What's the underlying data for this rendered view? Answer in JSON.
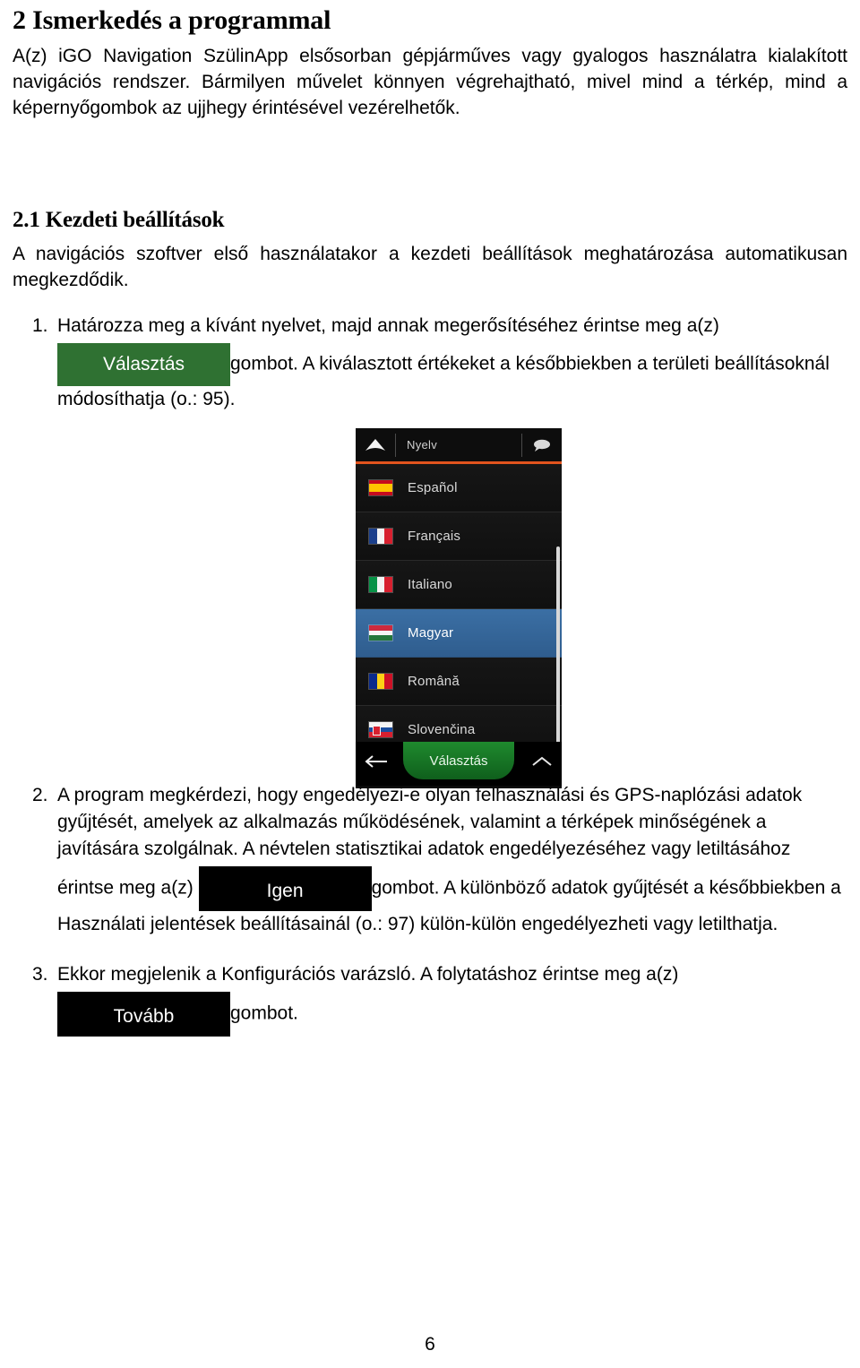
{
  "document": {
    "page_number": "6",
    "chapter_title": "2 Ismerkedés a programmal",
    "intro_paragraph": "A(z) iGO Navigation SzülinApp elsősorban gépjárműves vagy gyalogos használatra kialakított navigációs rendszer. Bármilyen művelet könnyen végrehajtható, mivel mind a térkép, mind a képernyőgombok az ujjhegy érintésével vezérelhetők.",
    "section_title": "2.1 Kezdeti beállítások",
    "section_paragraph": "A navigációs szoftver első használatakor a kezdeti beállítások meghatározása automatikusan megkezdődik."
  },
  "steps": [
    {
      "number": "1.",
      "text_before": "Határozza meg a kívánt nyelvet, majd annak megerősítéséhez érintse meg a(z)",
      "button_label": "Választás",
      "button_color": "#2f7132",
      "text_after": "gombot. A kiválasztott értékeket a későbbiekben a területi beállításoknál módosíthatja (o.: 95)."
    },
    {
      "number": "2.",
      "text_before": "A program megkérdezi, hogy engedélyezi-e olyan felhasználási és GPS-naplózási adatok gyűjtését, amelyek az alkalmazás működésének, valamint a térképek minőségének a javítására szolgálnak. A névtelen statisztikai adatok engedélyezéséhez vagy letiltásához",
      "lead_in": "érintse meg a(z)",
      "button_label": "Igen",
      "button_color": "#000000",
      "text_after": "gombot. A különböző adatok gyűjtését a későbbiekben a Használati jelentések beállításainál (o.: 97) külön-külön engedélyezheti vagy letilthatja."
    },
    {
      "number": "3.",
      "text_before": "Ekkor megjelenik a Konfigurációs varázsló. A folytatáshoz érintse meg a(z)",
      "button_label": "Tovább",
      "button_color": "#000000",
      "text_after": "gombot."
    }
  ],
  "device_screenshot": {
    "header": {
      "title": "Nyelv",
      "up_arrow_icon": "up-arrow-icon",
      "bubble_icon": "speech-bubble-icon",
      "accent_color": "#e2541e"
    },
    "languages": [
      {
        "name": "Español",
        "flag": "spain-flag-icon",
        "selected": false
      },
      {
        "name": "Français",
        "flag": "france-flag-icon",
        "selected": false
      },
      {
        "name": "Italiano",
        "flag": "italy-flag-icon",
        "selected": false
      },
      {
        "name": "Magyar",
        "flag": "hungary-flag-icon",
        "selected": true
      },
      {
        "name": "Română",
        "flag": "romania-flag-icon",
        "selected": false
      },
      {
        "name": "Slovenčina",
        "flag": "slovakia-flag-icon",
        "selected": false
      }
    ],
    "footer": {
      "back_icon": "back-arrow-icon",
      "confirm_label": "Választás",
      "up_icon": "chevron-up-icon"
    },
    "selected_highlight_color": "#35689a"
  }
}
